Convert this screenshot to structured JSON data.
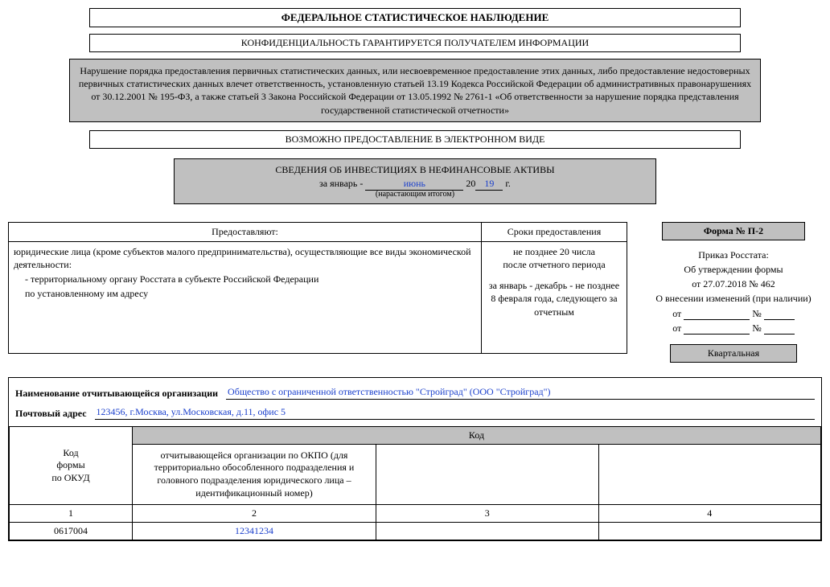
{
  "header": {
    "title": "ФЕДЕРАЛЬНОЕ СТАТИСТИЧЕСКОЕ НАБЛЮДЕНИЕ",
    "confidentiality": "КОНФИДЕНЦИАЛЬНОСТЬ ГАРАНТИРУЕТСЯ ПОЛУЧАТЕЛЕМ ИНФОРМАЦИИ",
    "warning": "Нарушение порядка предоставления первичных статистических данных, или несвоевременное предоставление этих данных, либо предоставление недостоверных первичных статистических данных влечет ответственность, установленную статьей 13.19 Кодекса Российской Федерации об административных правонарушениях от 30.12.2001 № 195-ФЗ, а также статьей 3 Закона Российской Федерации от 13.05.1992 № 2761-1 «Об ответственности за нарушение порядка представления государственной статистической отчетности»",
    "electronic": "ВОЗМОЖНО ПРЕДОСТАВЛЕНИЕ В ЭЛЕКТРОННОМ ВИДЕ"
  },
  "info": {
    "title": "СВЕДЕНИЯ ОБ ИНВЕСТИЦИЯХ В НЕФИНАНСОВЫЕ АКТИВЫ",
    "period_prefix": "за январь -",
    "month": "июнь",
    "year_prefix": "20",
    "year_suffix": "19",
    "year_g": "г.",
    "caption": "(нарастающим итогом)"
  },
  "provide": {
    "col1_header": "Предоставляют:",
    "col2_header": "Сроки предоставления",
    "providers_intro": "юридические лица (кроме субъектов малого предпринимательства), осуществляющие все виды экономической деятельности:",
    "providers_item1": "- территориальному органу Росстата в субъекте Российской Федерации",
    "providers_item2": "по установленному им адресу",
    "deadline_line1": "не позднее 20 числа",
    "deadline_line2": "после отчетного периода",
    "deadline_line3": "за январь - декабрь - не позднее 8 февраля года, следующего за отчетным"
  },
  "formbox": {
    "form_no": "Форма № П-2",
    "order_line1": "Приказ Росстата:",
    "order_line2": "Об утверждении формы",
    "order_line3": "от 27.07.2018 № 462",
    "order_line4": "О внесении изменений (при наличии)",
    "ot": "от",
    "no": "№",
    "periodicity": "Квартальная"
  },
  "org": {
    "name_label": "Наименование отчитывающейся организации",
    "name_value": "Общество с ограниченной ответственностью \"Стройград\" (ООО \"Стройград\")",
    "address_label": "Почтовый адрес",
    "address_value": "123456, г.Москва, ул.Московская, д.11, офис 5"
  },
  "codes": {
    "code_header": "Код",
    "okud_label_1": "Код",
    "okud_label_2": "формы",
    "okud_label_3": "по ОКУД",
    "okpo_desc": "отчитывающейся организации по ОКПО (для территориально обособленного подразделения и головного подразделения юридического лица – идентификационный номер)",
    "row_nums": {
      "c1": "1",
      "c2": "2",
      "c3": "3",
      "c4": "4"
    },
    "values": {
      "okud": "0617004",
      "okpo": "12341234",
      "c3": "",
      "c4": ""
    }
  }
}
